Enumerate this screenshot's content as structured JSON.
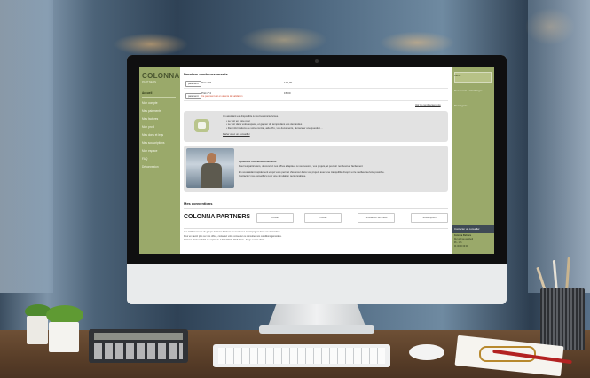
{
  "app": {
    "logo": "COLONNA",
    "logo_sub": "PARTNERS"
  },
  "sidebar": {
    "items": [
      {
        "label": "Accueil",
        "active": true
      },
      {
        "label": "Mon compte"
      },
      {
        "label": "Mes paiements"
      },
      {
        "label": "Mes factures"
      },
      {
        "label": "Mon profil"
      },
      {
        "label": "Mes dons et legs"
      },
      {
        "label": "Mes souscriptions"
      },
      {
        "label": "Mon espace"
      },
      {
        "label": "FAQ"
      },
      {
        "label": "Déconnexion"
      }
    ]
  },
  "main": {
    "last_payments_title": "Derniers remboursements",
    "rows": [
      {
        "tag": "paiement",
        "text": "Prêt n°8",
        "amount": "120,00",
        "warning": ""
      },
      {
        "tag": "paiement",
        "text": "Prêt n°4",
        "amount": "15,00",
        "warning": "Ce paiement est en attente de validation"
      }
    ],
    "more_link": "Voir les remboursements",
    "bot_card": {
      "lines": [
        "Un assistant est disponible à vos besoins/services.",
        "• Le voir en ligne pour",
        "• Le voir dans votre espace, et gagner du temps dans vos demandes",
        "• Des informations de votre contrat, aide Pro, vos documents, demander une question..."
      ],
      "link": "Parler avec un conseiller"
    },
    "promo_card": {
      "title": "Optimisez vos remboursements",
      "lines": [
        "Pour les particuliers, découvrez nos offres adaptées à vos besoins, vos projets, et pouvoir rembourser facilement",
        "En vous aidant rapidement et qui vous permet d'avancer dans vos projets avec une tranquillité d'esprit et le meilleur service possible.",
        "Contactez nos conseillers pour une simulation personnalisée."
      ]
    },
    "conv_title": "Mes conventions",
    "partners": {
      "title": "COLONNA PARTNERS",
      "buttons": [
        "Contact",
        "Profilez",
        "Simulateur de crédit",
        "Souscription"
      ]
    },
    "footer_lines": [
      "Les établissements du groupe Colonna Partners peuvent vous accompagner dans vos démarches.",
      "Pour en savoir plus sur nos offres, contactez votre conseiller ou consultez nos conditions générales.",
      "Colonna Partners SAS au capital de 1 000 000 € - RCS Paris - Siège social : Paris"
    ]
  },
  "rpanel": {
    "items": [
      "Alerte",
      "Documents à télécharger",
      "Messagerie"
    ],
    "contact_label": "Contacter un conseiller",
    "info_lines": [
      "Colonna Partners",
      "Du lundi au vendredi",
      "9h - 18h",
      "01 00 00 00 00"
    ]
  }
}
